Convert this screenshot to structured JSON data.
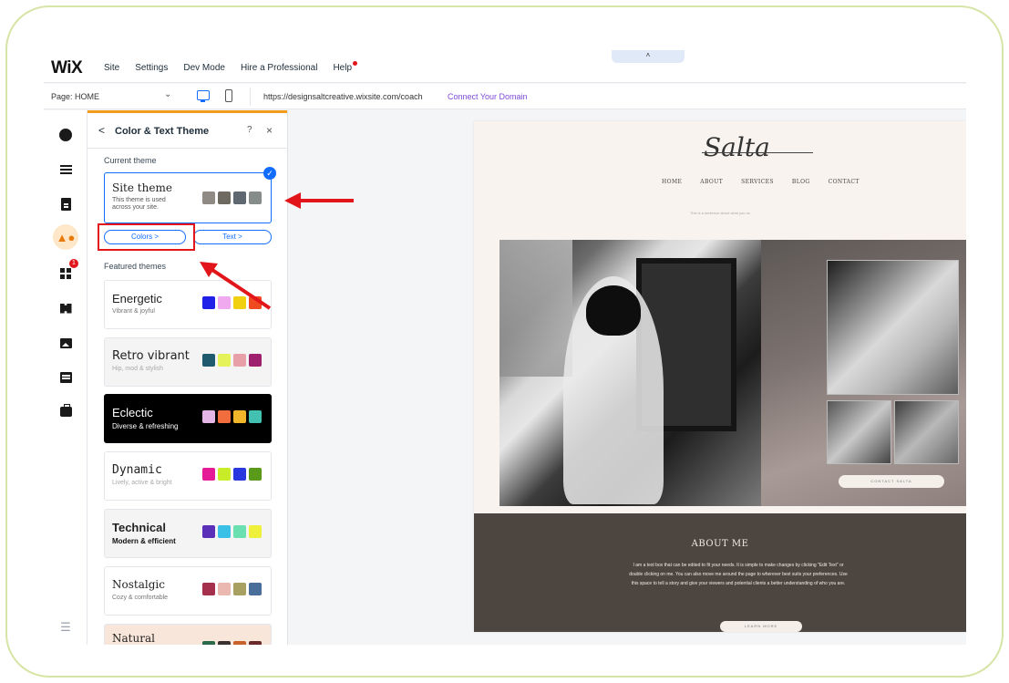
{
  "app": {
    "logo": "WiX",
    "menu": [
      "Site",
      "Settings",
      "Dev Mode",
      "Hire a Professional",
      "Help"
    ],
    "collapse_glyph": "˄"
  },
  "address_bar": {
    "page_label": "Page: HOME",
    "page_dropdown_icon": "chevron-down-icon",
    "url": "https://designsaltcreative.wixsite.com/coach",
    "connect_domain": "Connect Your Domain"
  },
  "rail": {
    "badge_count": "1",
    "icons": [
      "add-icon",
      "sections-icon",
      "pages-icon",
      "theme-icon",
      "apps-icon",
      "business-apps-icon",
      "media-icon",
      "cms-icon",
      "portfolio-icon",
      "layers-icon"
    ]
  },
  "panel": {
    "back": "<",
    "title": "Color & Text Theme",
    "help": "?",
    "close": "×",
    "current_label": "Current theme",
    "site_theme": {
      "name": "Site theme",
      "description": "This theme is used across your site.",
      "swatches": [
        "#8f8a83",
        "#6e6a62",
        "#5f6870",
        "#858c8a"
      ]
    },
    "colors_button": "Colors >",
    "text_button": "Text >",
    "featured_label": "Featured themes",
    "themes": [
      {
        "name": "Energetic",
        "sub": "Vibrant & joyful",
        "bg": "#ffffff",
        "fg": "#222222",
        "swatches": [
          "#2020e8",
          "#f0a8ee",
          "#f0d010",
          "#f04a20"
        ]
      },
      {
        "name": "Retro vibrant",
        "sub": "Hip, mod & stylish",
        "bg": "#f3f4f3",
        "fg": "#333333",
        "swatches": [
          "#1f5a6e",
          "#e6f25a",
          "#e8a0a8",
          "#a02070"
        ]
      },
      {
        "name": "Eclectic",
        "sub": "Diverse & refreshing",
        "bg": "#000000",
        "fg": "#ffffff",
        "swatches": [
          "#e4b6e6",
          "#f26d3d",
          "#f2b62a",
          "#42c0b0"
        ]
      },
      {
        "name": "Dynamic",
        "sub": "Lively, active & bright",
        "bg": "#ffffff",
        "fg": "#333333",
        "swatches": [
          "#e41a96",
          "#c8ec28",
          "#2a38e0",
          "#5a9a1a"
        ]
      },
      {
        "name": "Technical",
        "sub": "Modern & efficient",
        "bg": "#f3f4f3",
        "fg": "#111111",
        "swatches": [
          "#5a30b8",
          "#3ac0e6",
          "#6ae0b0",
          "#eef03a"
        ]
      },
      {
        "name": "Nostalgic",
        "sub": "Cozy & comfortable",
        "bg": "#ffffff",
        "fg": "#444444",
        "swatches": [
          "#a5304e",
          "#eab8b0",
          "#a8a060",
          "#4a6e9a"
        ]
      },
      {
        "name": "Natural",
        "sub": "",
        "bg": "#f9e6da",
        "fg": "#333333",
        "swatches": [
          "#2a6a4a",
          "#3a3030",
          "#c8602a",
          "#6a2a2a"
        ]
      }
    ]
  },
  "site": {
    "logo": "Salta",
    "nav": [
      "HOME",
      "ABOUT",
      "SERVICES",
      "BLOG",
      "CONTACT"
    ],
    "tagline": "This is a sentence about what you do",
    "contact_button": "CONTACT SALTA",
    "about_title": "ABOUT ME",
    "about_text": "I am a text box that can be edited to fit your needs. It is simple to make changes by clicking \"Edit Text\" or double clicking on me. You can also move me around the page to wherever best suits your preferences. Use this space to tell a story and give your viewers and potential clients a better understanding of who you are.",
    "learn_button": "LEARN MORE"
  },
  "colors": {
    "accent": "#116dff",
    "annotation": "#e2151a",
    "progress": "#f39b1b",
    "frame_border": "#d6e4a6"
  }
}
